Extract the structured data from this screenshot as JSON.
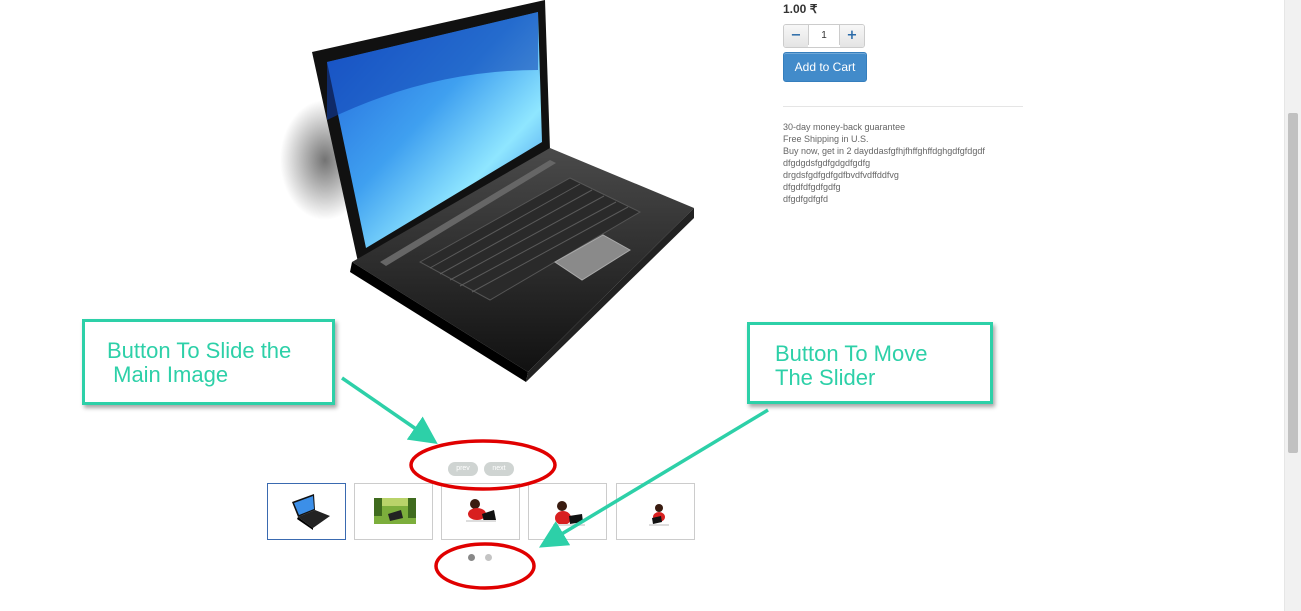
{
  "product": {
    "price": "1.00 ₹",
    "quantity": "1",
    "decrement_label": "−",
    "increment_label": "+",
    "add_to_cart_label": "Add to Cart",
    "description_lines": [
      "30-day money-back guarantee",
      "Free Shipping in U.S.",
      "Buy now, get in 2 dayddasfgfhjfhffghffdghgdfgfdgdf",
      "dfgdgdsfgdfgdgdfgdfg",
      "drgdsfgdfgdfgdfbvdfvdffddfvg",
      "dfgdfdfgdfgdfg",
      "dfgdfgdfgfd"
    ]
  },
  "slider": {
    "prev_label": "prev",
    "next_label": "next",
    "thumbnails": [
      {
        "icon": "laptop-thumbnail",
        "active": true
      },
      {
        "icon": "laptop-on-grass-thumbnail",
        "active": false
      },
      {
        "icon": "woman-with-laptop-thumbnail",
        "active": false
      },
      {
        "icon": "woman-with-laptop-thumbnail",
        "active": false
      },
      {
        "icon": "woman-with-laptop-thumbnail",
        "active": false
      }
    ],
    "dots": [
      {
        "active": true
      },
      {
        "active": false
      }
    ]
  },
  "annotations": {
    "left_line1": "Button To Slide the",
    "left_line2": " Main Image",
    "right_line1": "Button To Move",
    "right_line2": "The Slider"
  },
  "colors": {
    "annotation": "#2dd0a8",
    "highlight_ellipse": "#e00000",
    "cart_button": "#428bca"
  }
}
